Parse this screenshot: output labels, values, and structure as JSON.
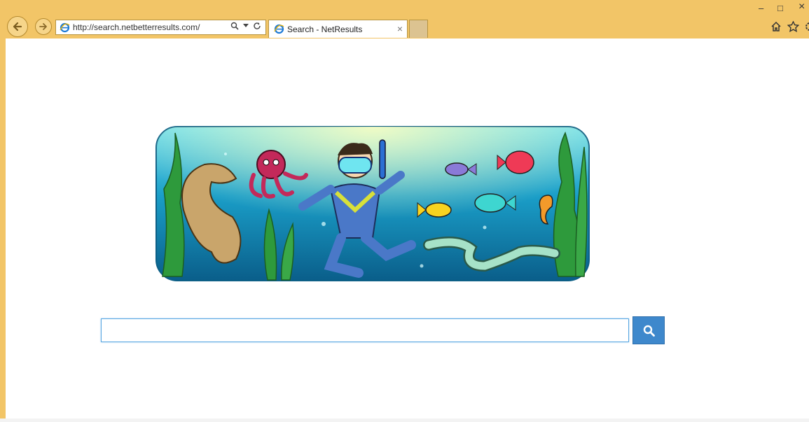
{
  "browser": {
    "address_url": "http://search.netbetterresults.com/",
    "tab_title": "Search - NetResults",
    "tab_close": "×",
    "window_controls": {
      "minimize": "–",
      "maximize": "□",
      "close": "×"
    }
  },
  "icons": [
    "back-icon",
    "forward-icon",
    "ie-logo-icon",
    "search-icon",
    "dropdown-icon",
    "refresh-icon",
    "close-icon",
    "home-icon",
    "favorites-star-icon",
    "settings-gear-icon",
    "magnifier-icon"
  ],
  "colors": {
    "frame": "#f2c567",
    "search_button": "#3e88cc",
    "search_border": "#59a7e2"
  },
  "search": {
    "placeholder": ""
  }
}
